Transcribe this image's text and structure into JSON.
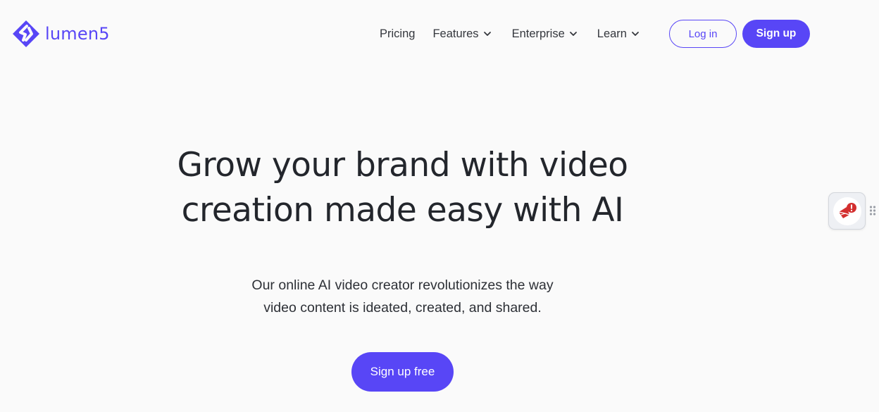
{
  "brand": {
    "name": "lumen5",
    "accent_color": "#5846f6"
  },
  "nav": {
    "items": [
      {
        "label": "Pricing",
        "has_dropdown": false
      },
      {
        "label": "Features",
        "has_dropdown": true
      },
      {
        "label": "Enterprise",
        "has_dropdown": true
      },
      {
        "label": "Learn",
        "has_dropdown": true
      }
    ],
    "login_label": "Log in",
    "signup_label": "Sign up"
  },
  "hero": {
    "title_line1": "Grow your brand with video",
    "title_line2": "creation made easy with AI",
    "subtitle_line1": "Our online AI video creator revolutionizes the way",
    "subtitle_line2": "video content is ideated, created, and shared.",
    "cta_label": "Sign up free"
  },
  "extension_widget": {
    "icon": "mail-alert-icon",
    "alert_color": "#d32f2f"
  }
}
